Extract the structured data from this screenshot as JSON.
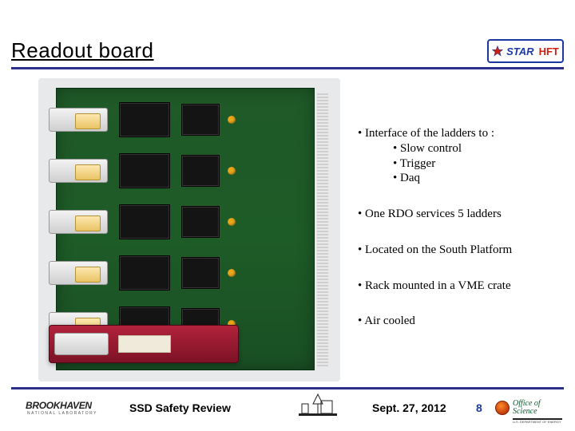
{
  "header": {
    "title": "Readout board",
    "logo_left": "STAR",
    "logo_right": "HFT"
  },
  "content": {
    "b1": "Interface of the ladders to :",
    "b1a": "Slow control",
    "b1b": "Trigger",
    "b1c": "Daq",
    "b2": "One RDO services 5 ladders",
    "b3": "Located on the South Platform",
    "b4": "Rack mounted in a VME crate",
    "b5": "Air cooled"
  },
  "footer": {
    "brook": "BROOKHAVEN",
    "brook_sub": "NATIONAL LABORATORY",
    "review": "SSD Safety Review",
    "date": "Sept.  27, 2012",
    "page": "8",
    "science_top": "Office of",
    "science_bottom": "Science",
    "doe": "U.S. DEPARTMENT OF ENERGY"
  }
}
